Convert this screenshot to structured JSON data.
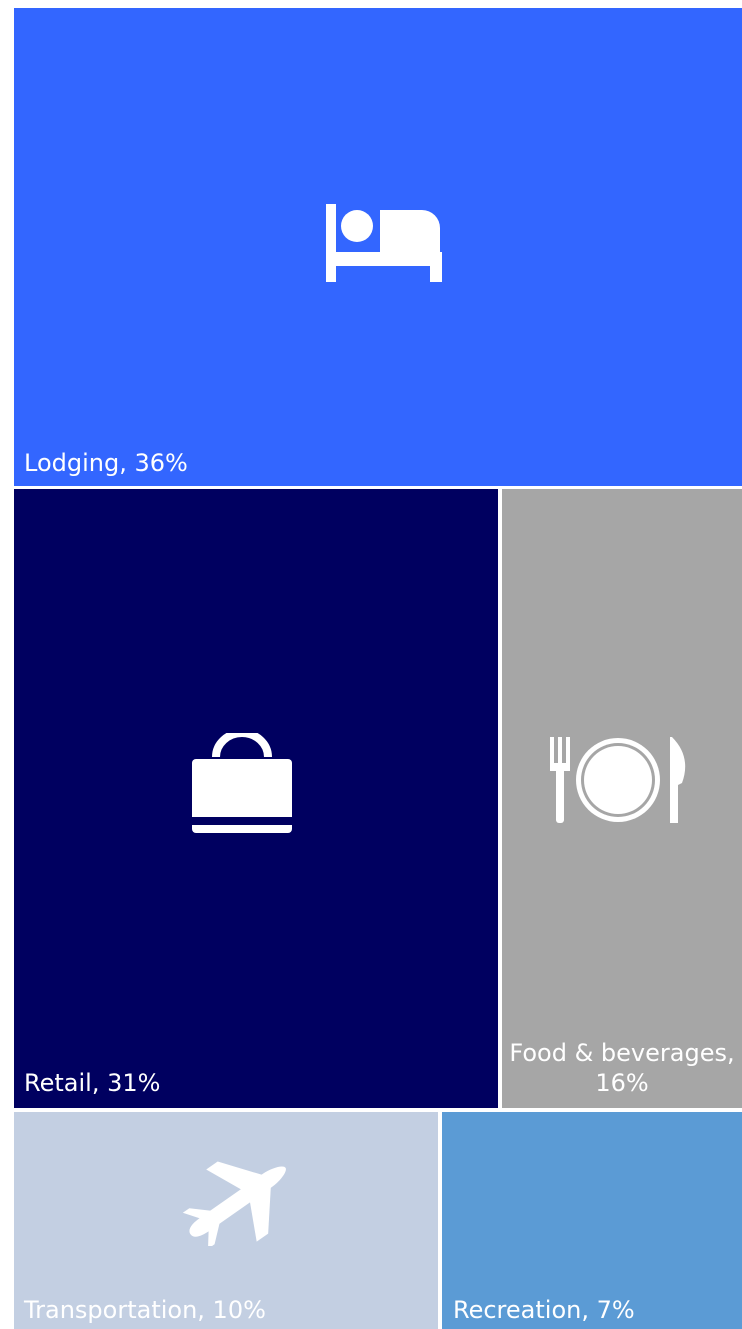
{
  "chart_data": {
    "type": "treemap",
    "items": [
      {
        "category": "Lodging",
        "value": 36,
        "label": "Lodging, 36%",
        "color": "#3366ff",
        "icon": "bed-icon"
      },
      {
        "category": "Retail",
        "value": 31,
        "label": "Retail, 31%",
        "color": "#000060",
        "icon": "shopping-bag-icon"
      },
      {
        "category": "Food & beverages",
        "value": 16,
        "label": "Food & beverages, 16%",
        "color": "#a6a6a6",
        "icon": "fork-plate-knife-icon"
      },
      {
        "category": "Transportation",
        "value": 10,
        "label": "Transportation, 10%",
        "color": "#c3cfe2",
        "icon": "airplane-icon"
      },
      {
        "category": "Recreation",
        "value": 7,
        "label": "Recreation, 7%",
        "color": "#5b9bd5",
        "icon": ""
      }
    ]
  }
}
